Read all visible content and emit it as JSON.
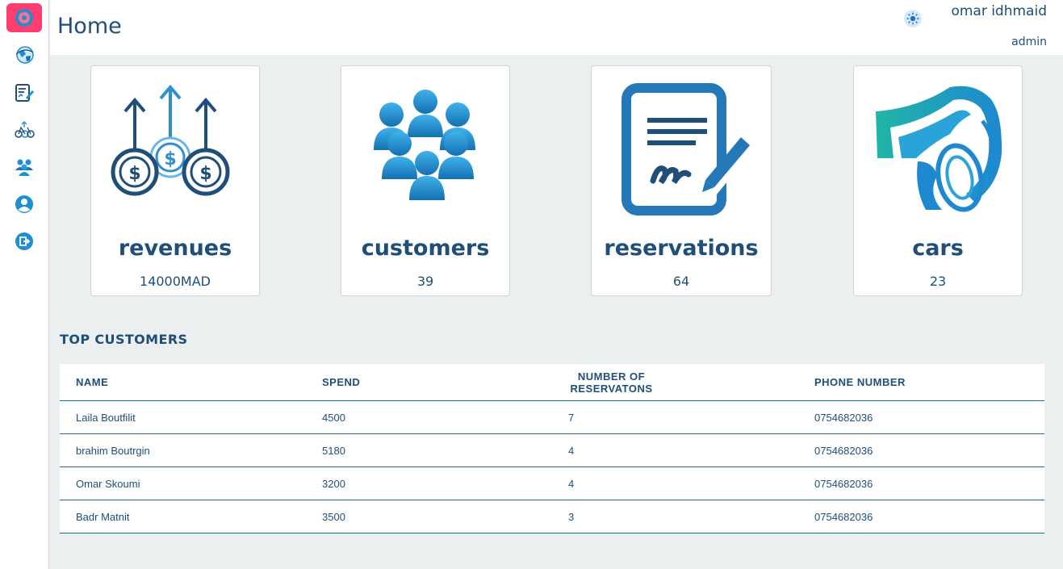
{
  "header": {
    "title": "Home",
    "user_name": "omar idhmaid",
    "user_role": "admin"
  },
  "sidebar": {
    "items": [
      {
        "icon": "dashboard-icon",
        "active": true
      },
      {
        "icon": "globe-icon"
      },
      {
        "icon": "report-edit-icon"
      },
      {
        "icon": "bikes-icon"
      },
      {
        "icon": "users-group-icon"
      },
      {
        "icon": "profile-icon"
      },
      {
        "icon": "logout-icon"
      }
    ]
  },
  "stats": [
    {
      "label": "revenues",
      "value": "14000MAD",
      "icon": "money-growth-icon"
    },
    {
      "label": "customers",
      "value": "39",
      "icon": "customers-group-icon"
    },
    {
      "label": "reservations",
      "value": "64",
      "icon": "contract-sign-icon"
    },
    {
      "label": "cars",
      "value": "23",
      "icon": "sports-car-icon"
    }
  ],
  "top_customers": {
    "title": "TOP CUSTOMERS",
    "columns": [
      "NAME",
      "SPEND",
      "NUMBER OF RESERVATONS",
      "PHONE NUMBER"
    ],
    "rows": [
      [
        "Laila Boutfilit",
        "4500",
        "7",
        "0754682036"
      ],
      [
        "brahim Boutrgin",
        "5180",
        "4",
        "0754682036"
      ],
      [
        "Omar Skoumi",
        "3200",
        "4",
        "0754682036"
      ],
      [
        "Badr Matnit",
        "3500",
        "3",
        "0754682036"
      ]
    ]
  },
  "colors": {
    "primary": "#1f4e79",
    "accent": "#1e90d2",
    "active_nav": "#ff3d6e",
    "background": "#eceff0"
  }
}
